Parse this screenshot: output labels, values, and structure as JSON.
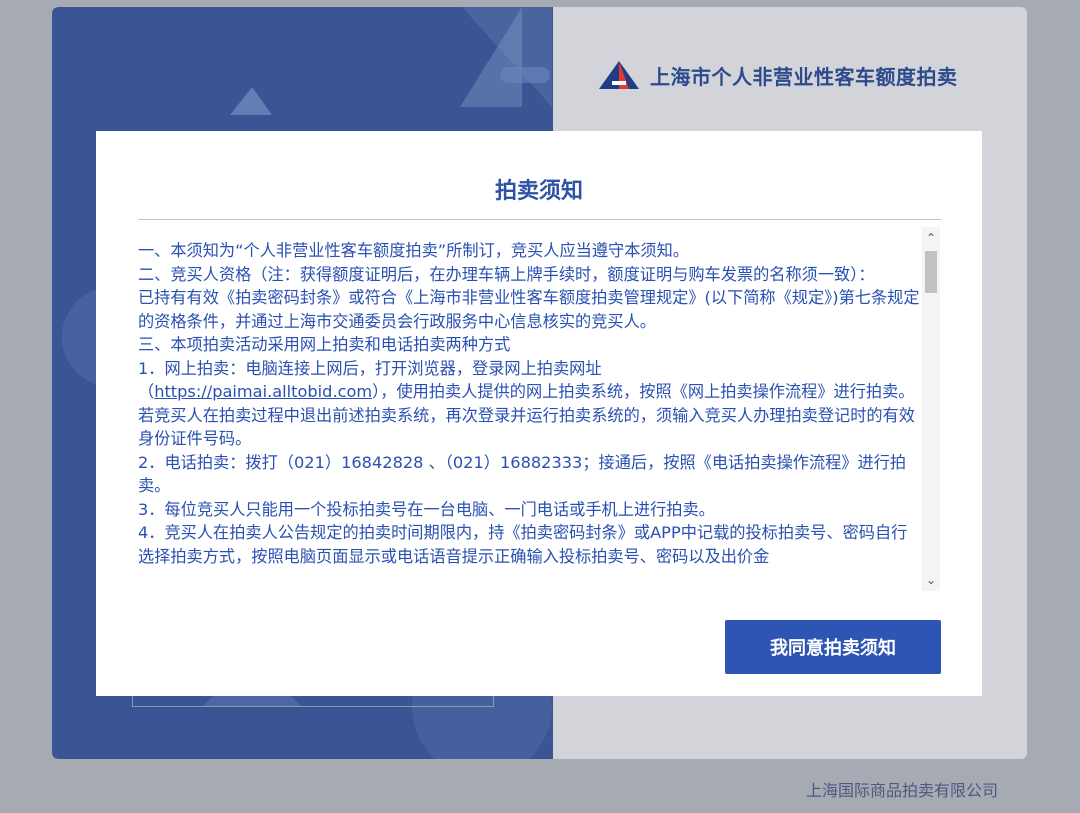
{
  "background": {
    "brand_title": "上海市个人非营业性客车额度拍卖",
    "company": "上海国际商品拍卖有限公司"
  },
  "modal": {
    "title": "拍卖须知",
    "lines": [
      "一、本须知为“个人非营业性客车额度拍卖”所制订，竞买人应当遵守本须知。",
      "二、竞买人资格（注：获得额度证明后，在办理车辆上牌手续时，额度证明与购车发票的名称须一致）：",
      "已持有有效《拍卖密码封条》或符合《上海市非营业性客车额度拍卖管理规定》(以下简称《规定》)第七条规定的资格条件，并通过上海市交通委员会行政服务中心信息核实的竞买人。",
      "三、本项拍卖活动采用网上拍卖和电话拍卖两种方式",
      "1．网上拍卖：电脑连接上网后，打开浏览器，登录网上拍卖网址"
    ],
    "line_link_prefix": "（",
    "link": "https://paimai.alltobid.com",
    "line_link_suffix": "），使用拍卖人提供的网上拍卖系统，按照《网上拍卖操作流程》进行拍卖。若竞买人在拍卖过程中退出前述拍卖系统，再次登录并运行拍卖系统的，须输入竞买人办理拍卖登记时的有效身份证件号码。",
    "lines_after": [
      "2．电话拍卖：拨打（021）16842828 、（021）16882333；接通后，按照《电话拍卖操作流程》进行拍卖。",
      "3．每位竞买人只能用一个投标拍卖号在一台电脑、一门电话或手机上进行拍卖。",
      "4．竞买人在拍卖人公告规定的拍卖时间期限内，持《拍卖密码封条》或APP中记载的投标拍卖号、密码自行选择拍卖方式，按照电脑页面显示或电话语音提示正确输入投标拍卖号、密码以及出价金"
    ],
    "scroll_up": "⌃",
    "scroll_down": "⌄",
    "agree_label": "我同意拍卖须知"
  },
  "colors": {
    "accent": "#2e55b3",
    "text_blue": "#2950b2",
    "left_panel": "#3a5593"
  }
}
